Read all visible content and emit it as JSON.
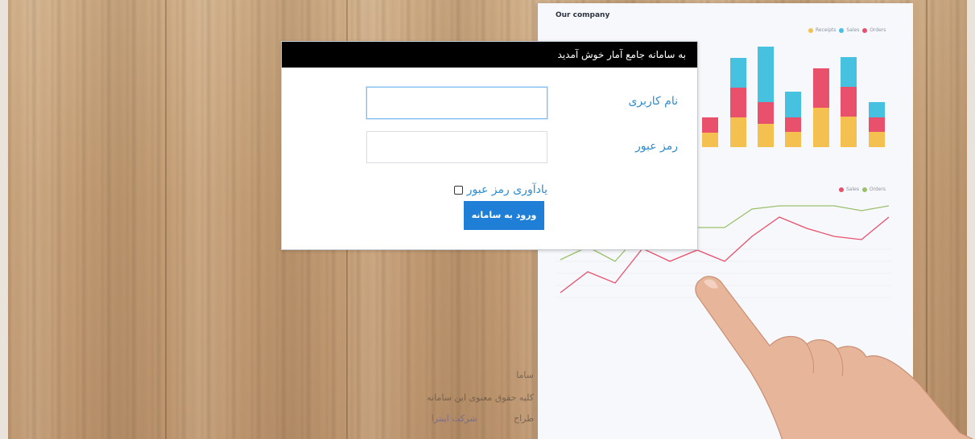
{
  "dialog": {
    "title": "به سامانه جامع آمار خوش آمدید",
    "username_label": "نام کاربری",
    "username_value": "",
    "password_label": "رمز عبور",
    "password_value": "",
    "remember_label": "یادآوری رمز عبور",
    "remember_checked": false,
    "login_button": "ورود به سامانه"
  },
  "background_paper": {
    "title": "Our company",
    "legend_top": [
      "Receipts",
      "Sales",
      "Orders"
    ],
    "legend_bottom": [
      "Sales",
      "Orders"
    ]
  },
  "footer": {
    "line1": "ساما",
    "line2": "کلیه حقوق معنوی این سامانه",
    "line3": "طراح",
    "link": "شرکت اینترا"
  },
  "colors": {
    "header_bg": "#000000",
    "label_blue": "#2f8ccf",
    "button_blue": "#1f7fd7",
    "bar_yellow": "#f4c04f",
    "bar_red": "#e8506b",
    "bar_cyan": "#47c1e0",
    "line_green": "#9ac06a"
  }
}
